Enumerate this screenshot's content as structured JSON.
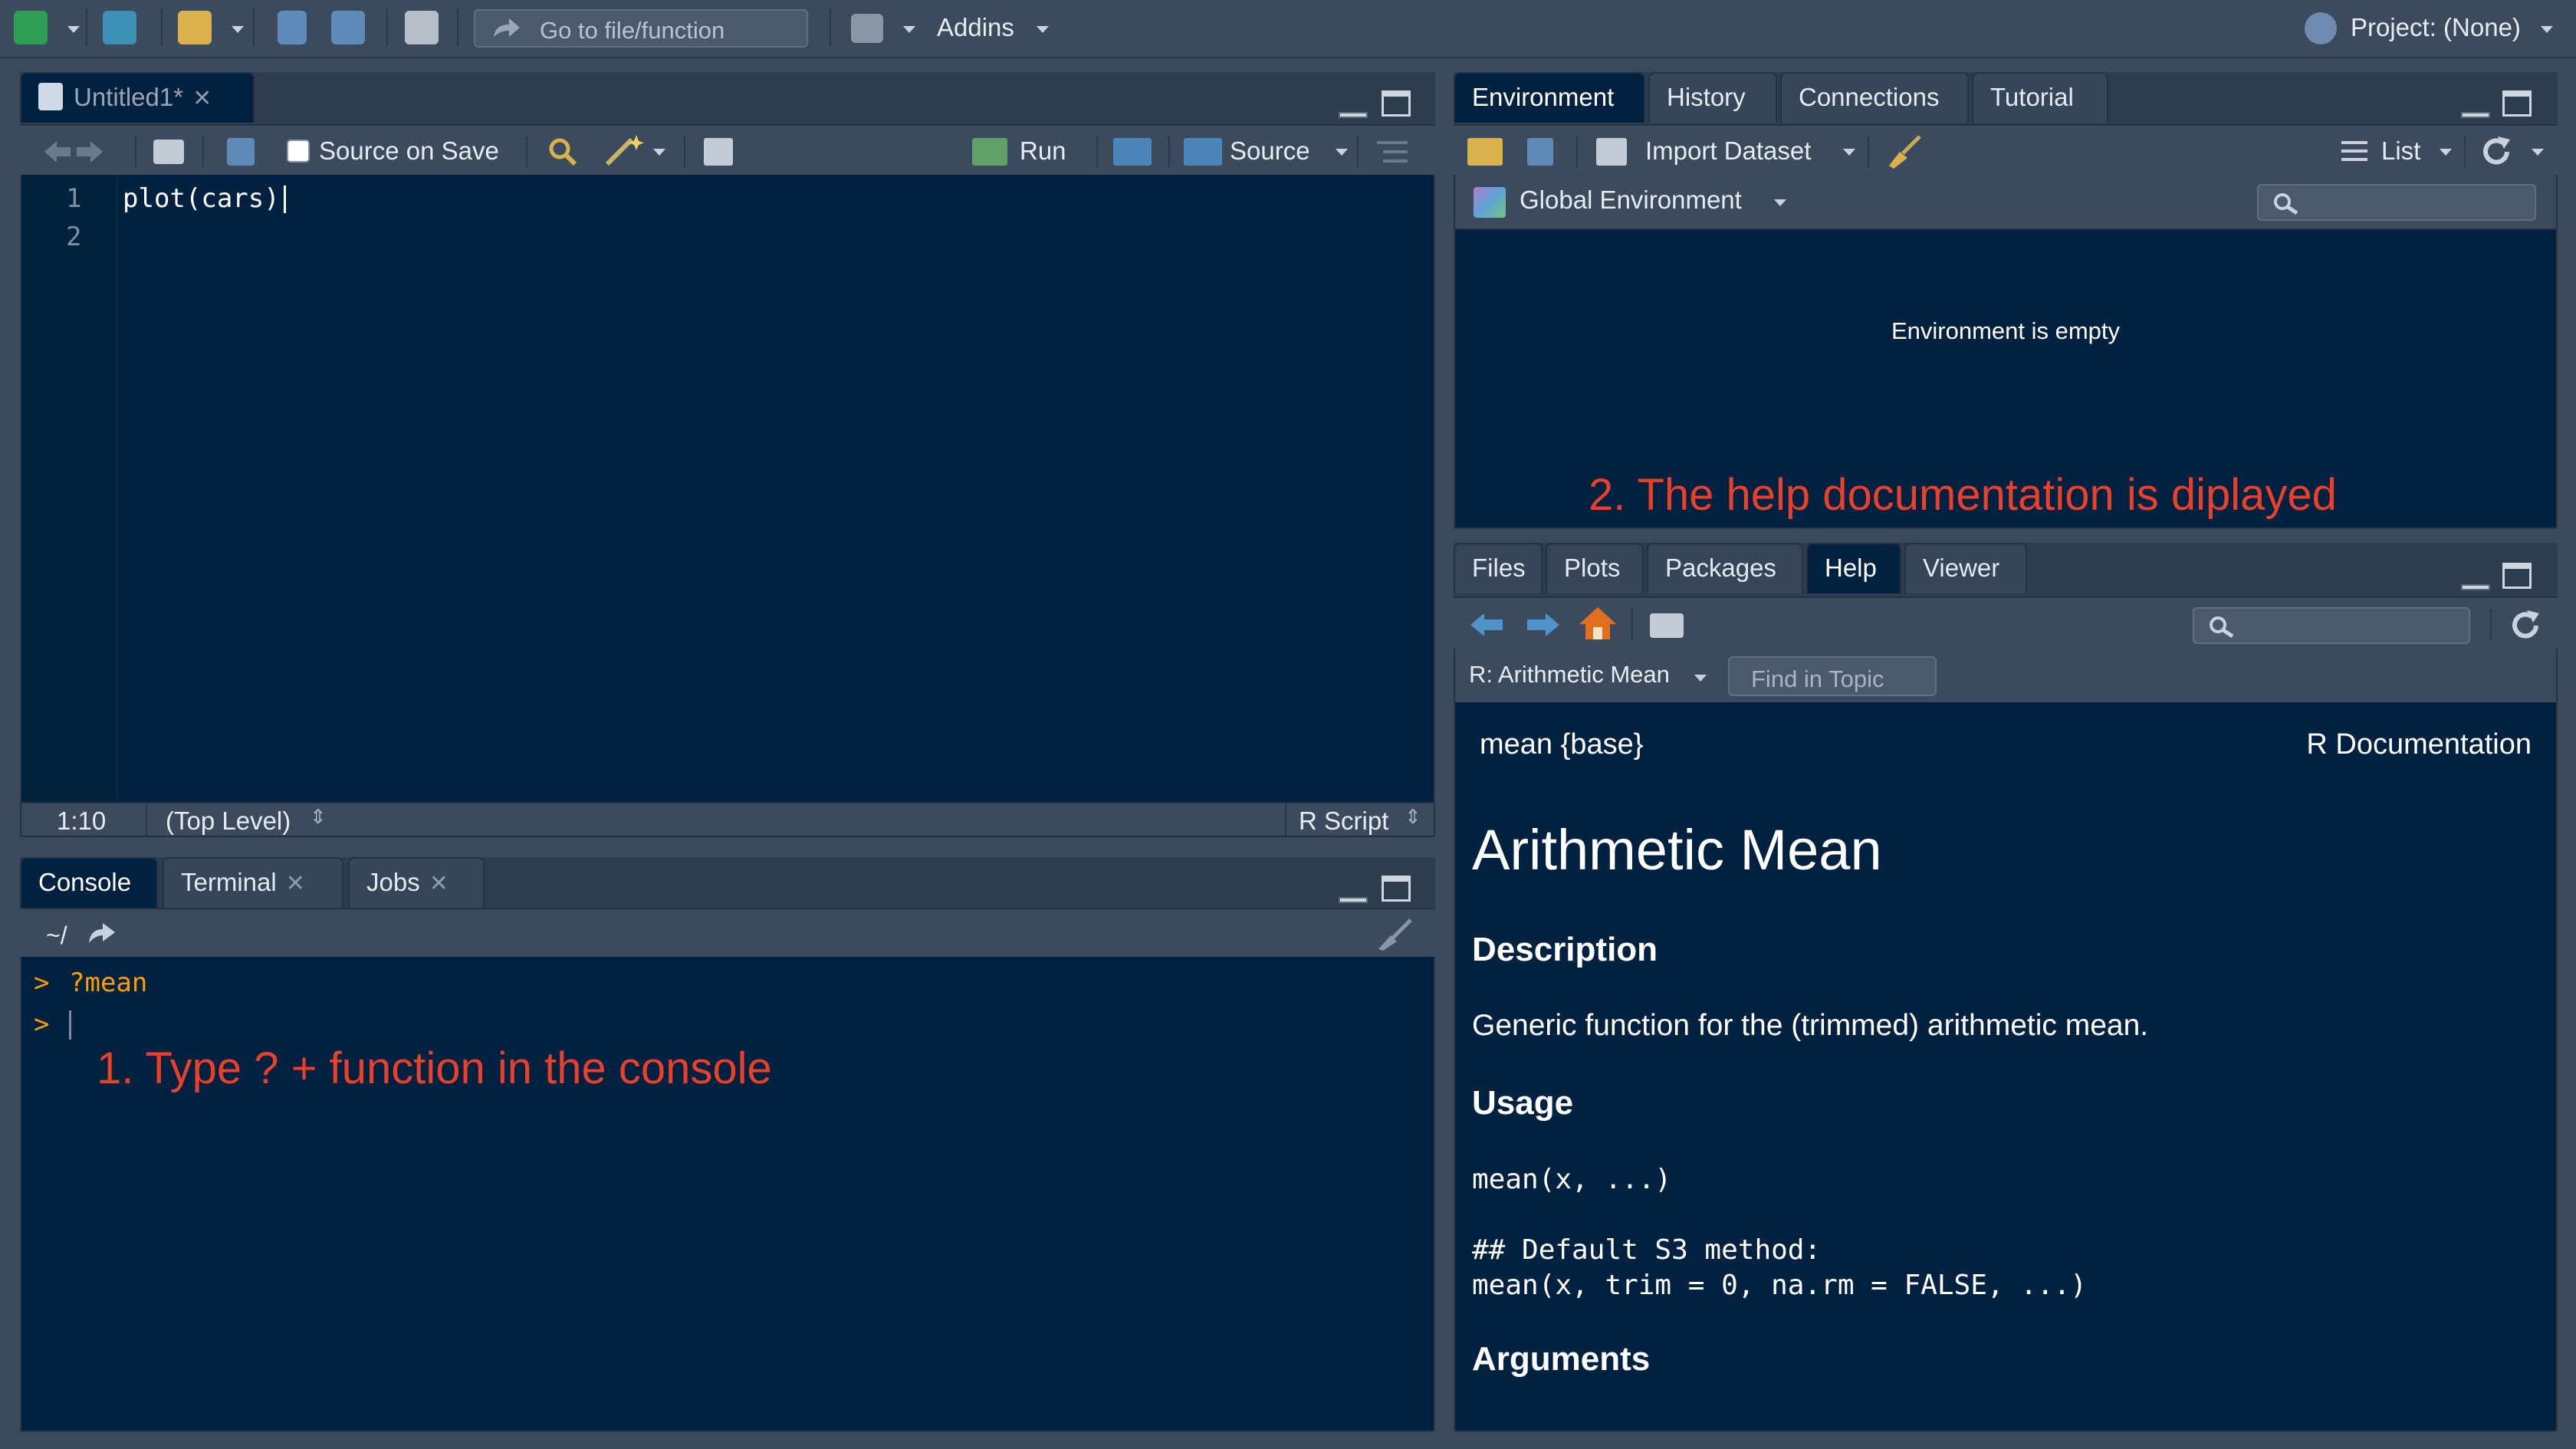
{
  "topbar": {
    "goto_placeholder": "Go to file/function",
    "addins_label": "Addins",
    "project_label": "Project: (None)"
  },
  "editor": {
    "tab_label": "Untitled1*",
    "source_on_save": "Source on Save",
    "run_label": "Run",
    "source_label": "Source",
    "lines": [
      {
        "num": "1",
        "code": "plot(cars)"
      },
      {
        "num": "2",
        "code": ""
      }
    ],
    "status_position": "1:10",
    "status_scope": "(Top Level)",
    "status_type": "R Script"
  },
  "console": {
    "tabs": [
      "Console",
      "Terminal",
      "Jobs"
    ],
    "path": "~/",
    "lines": [
      {
        "prompt": ">",
        "text": "?mean"
      },
      {
        "prompt": ">",
        "text": ""
      }
    ]
  },
  "environment": {
    "tabs": [
      "Environment",
      "History",
      "Connections",
      "Tutorial"
    ],
    "import_dataset": "Import Dataset",
    "list_label": "List",
    "global_env": "Global Environment",
    "empty_message": "Environment is empty"
  },
  "help_pane": {
    "tabs": [
      "Files",
      "Plots",
      "Packages",
      "Help",
      "Viewer"
    ],
    "topic_label": "R: Arithmetic Mean",
    "find_placeholder": "Find in Topic",
    "doc_left": "mean {base}",
    "doc_right": "R Documentation",
    "title": "Arithmetic Mean",
    "desc_heading": "Description",
    "desc_text": "Generic function for the (trimmed) arithmetic mean.",
    "usage_heading": "Usage",
    "usage_code": [
      "mean(x, ...)",
      "",
      "## Default S3 method:",
      "mean(x, trim = 0, na.rm = FALSE, ...)"
    ],
    "args_heading": "Arguments"
  },
  "annotations": {
    "step1": "1. Type ? + function in the console",
    "step2": "2. The help documentation is diplayed"
  },
  "colors": {
    "pane_bg": "#002240",
    "chrome": "#3b4b5d",
    "annotation": "#e8402a",
    "prompt": "#ff9d00"
  }
}
